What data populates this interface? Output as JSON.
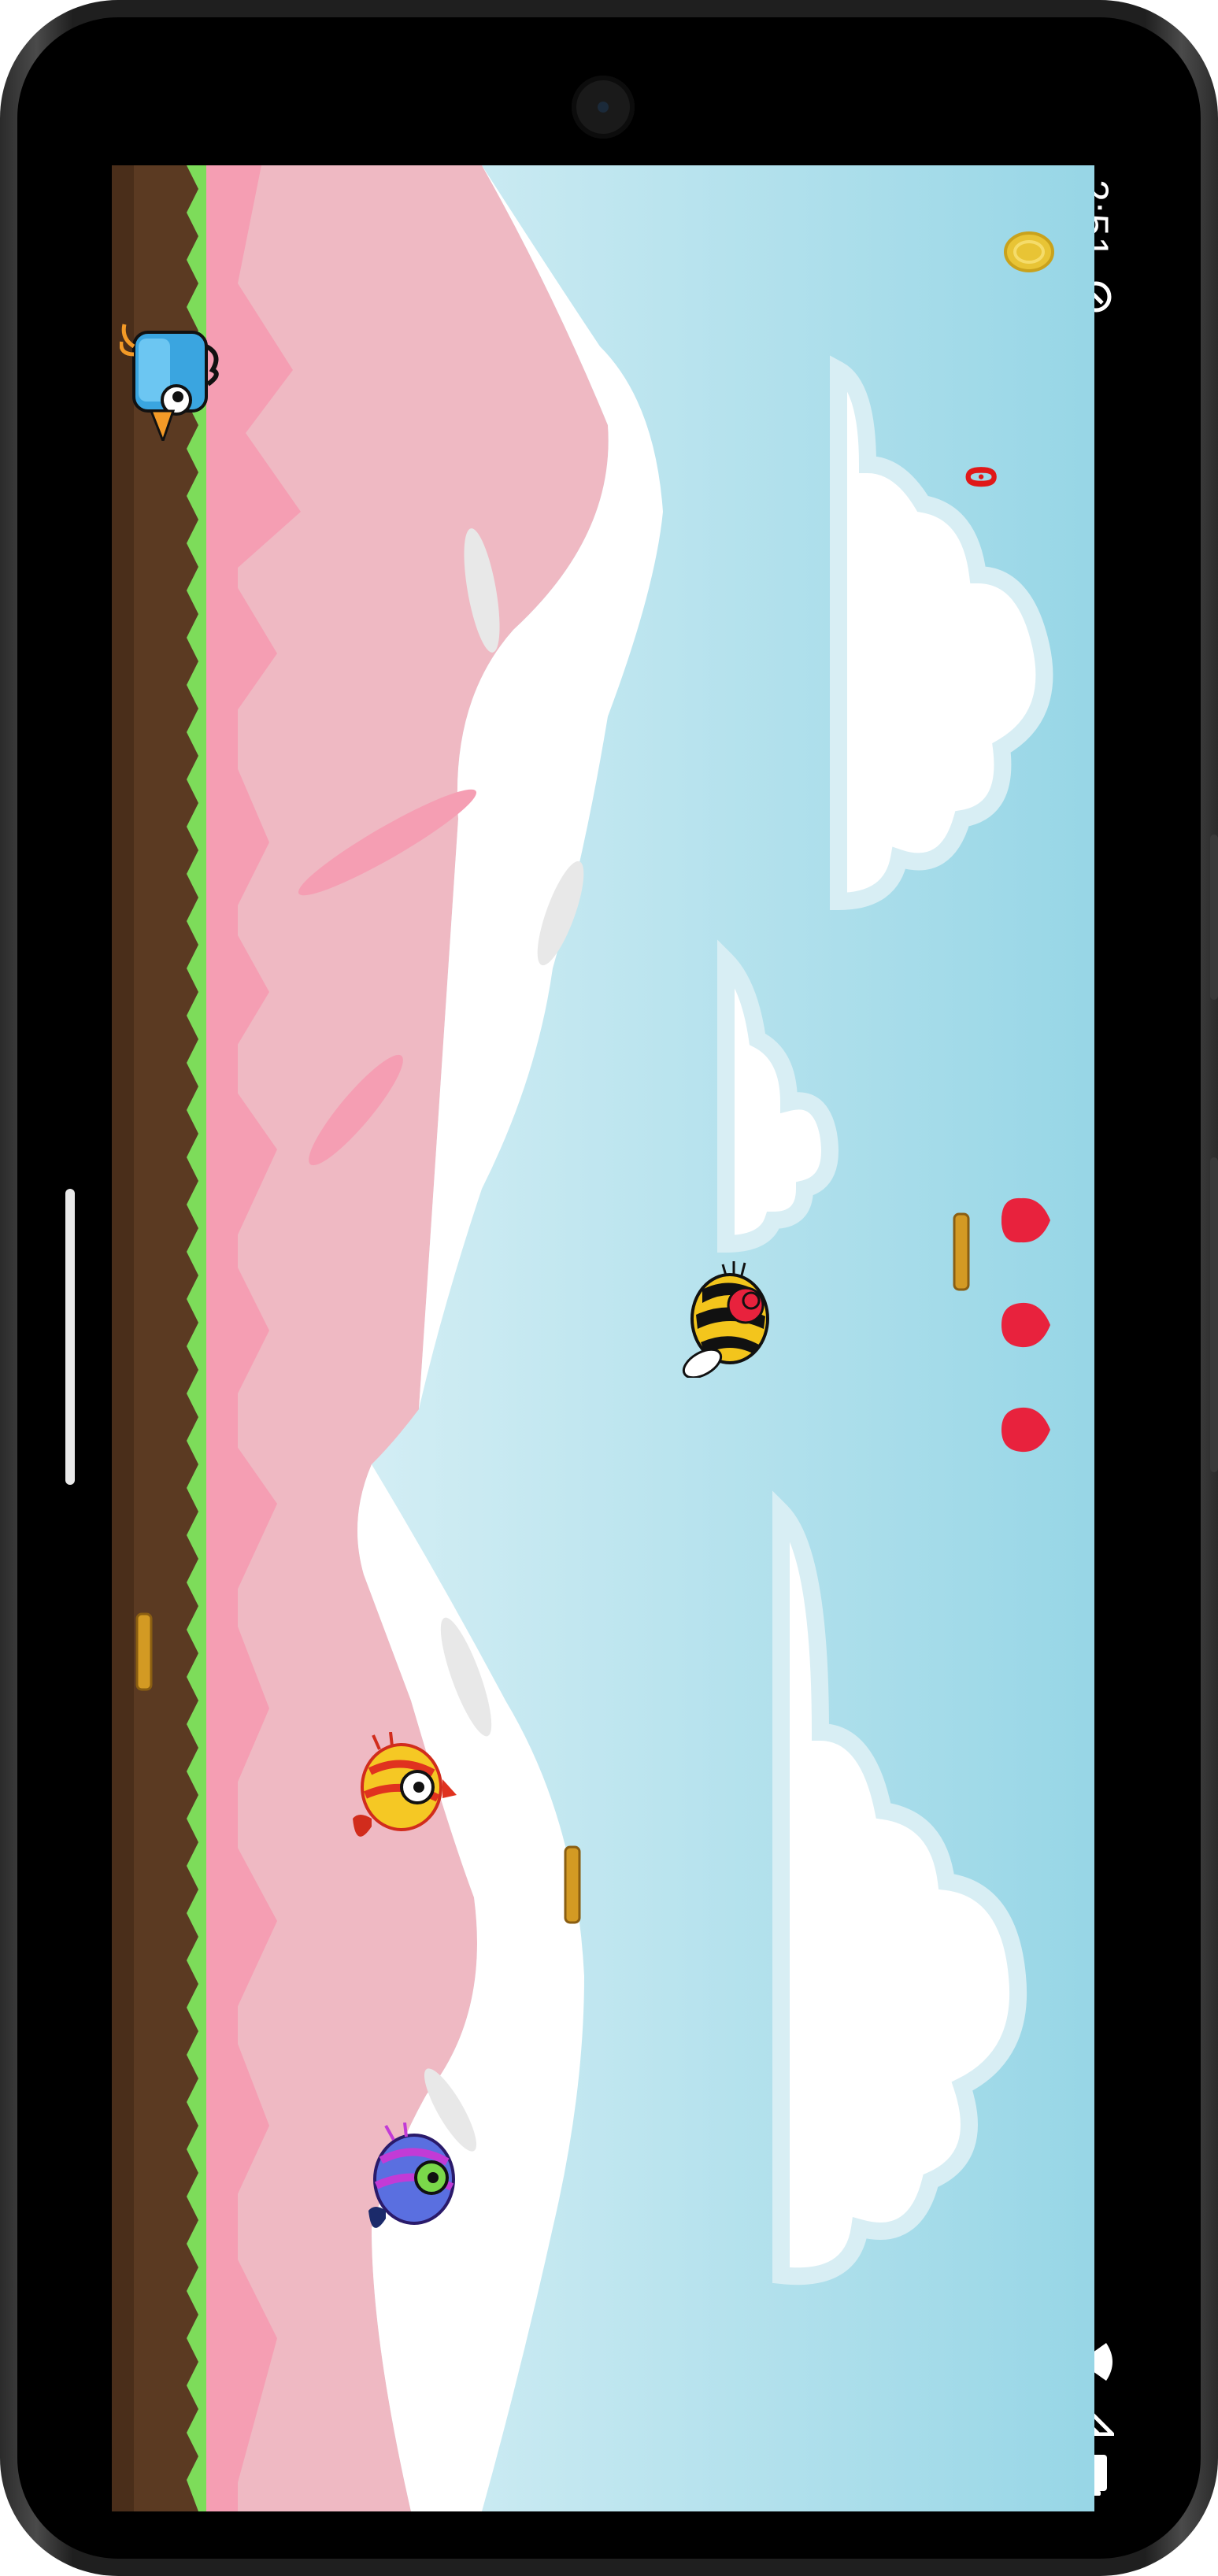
{
  "status_bar": {
    "time": "2:51",
    "icons": [
      "vpn-key-icon",
      "wifi-icon",
      "cell-signal-icon",
      "battery-icon"
    ]
  },
  "hud": {
    "coin_icon": "coin-icon",
    "coin_count": "0",
    "lives": 3,
    "life_icon": "heart-icon"
  },
  "scene": {
    "background": "mountain-sky",
    "colors": {
      "sky_top": "#9ad7e6",
      "sky_bottom": "#e4f4f8",
      "mountain": "#efb9c3",
      "mountain_shadow": "#f59eb3",
      "snow": "#ffffff",
      "grass": "#7ddc5a",
      "dirt": "#5b3a22",
      "heart": "#e8223d",
      "coin": "#e8c435",
      "score": "#e01818"
    }
  },
  "entities": [
    {
      "kind": "player-bird",
      "color": "blue"
    },
    {
      "kind": "bee-enemy",
      "color": "yellow-black"
    },
    {
      "kind": "bird-enemy",
      "color": "yellow-red"
    },
    {
      "kind": "bird-enemy",
      "color": "purple-blue"
    },
    {
      "kind": "coin-pickup"
    },
    {
      "kind": "coin-pickup"
    },
    {
      "kind": "coin-pickup"
    }
  ]
}
